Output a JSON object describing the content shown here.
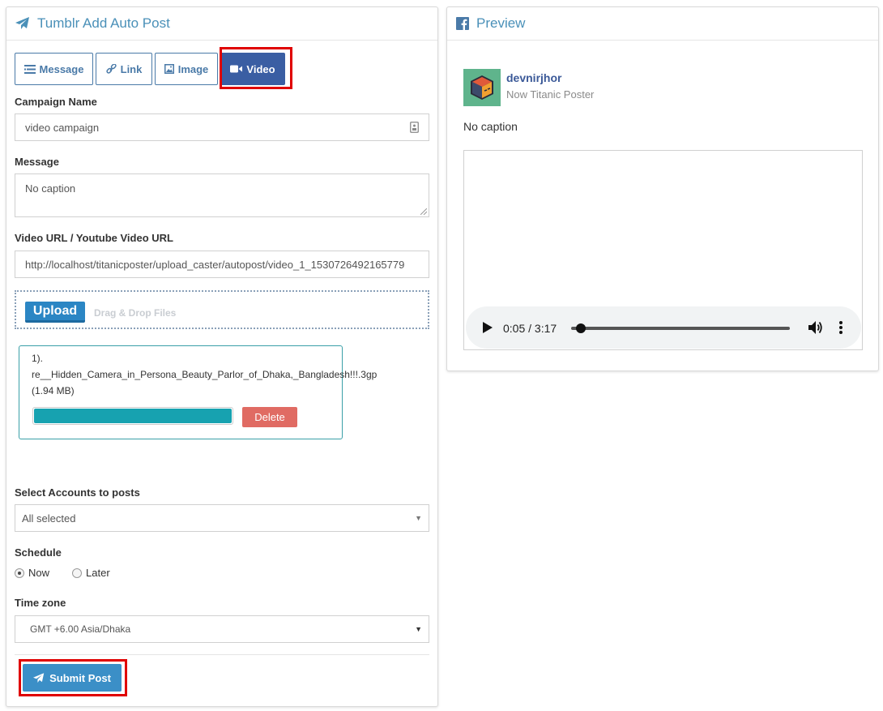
{
  "composer": {
    "title": "Tumblr Add Auto Post",
    "tabs": [
      {
        "label": "Message"
      },
      {
        "label": "Link"
      },
      {
        "label": "Image"
      },
      {
        "label": "Video",
        "active": true
      }
    ],
    "campaign_label": "Campaign Name",
    "campaign_value": "video campaign",
    "message_label": "Message",
    "message_value": "No caption",
    "video_url_label": "Video URL / Youtube Video URL",
    "video_url_value": "http://localhost/titanicposter/upload_caster/autopost/video_1_1530726492165779",
    "upload": {
      "button_label": "Upload",
      "hint": "Drag & Drop Files"
    },
    "file": {
      "index": "1).",
      "name": "re__Hidden_Camera_in_Persona_Beauty_Parlor_of_Dhaka,_Bangladesh!!!.3gp",
      "size": "(1.94 MB)",
      "progress": 1.0,
      "delete_label": "Delete"
    },
    "accounts_label": "Select Accounts to posts",
    "accounts_value": "All selected",
    "schedule_label": "Schedule",
    "schedule_options": [
      {
        "label": "Now",
        "checked": true
      },
      {
        "label": "Later",
        "checked": false
      }
    ],
    "timezone_label": "Time zone",
    "timezone_value": "GMT +6.00 Asia/Dhaka",
    "submit_label": "Submit Post"
  },
  "preview": {
    "title": "Preview",
    "username": "devnirjhor",
    "subtitle": "Now Titanic Poster",
    "caption": "No caption",
    "player": {
      "time": "0:05 / 3:17",
      "progress": 0.026
    }
  },
  "colors": {
    "accent": "#4a90b8",
    "active_tab": "#3a5ea3",
    "highlight": "#e00000",
    "progress": "#17a2b0",
    "delete": "#e06b63"
  }
}
